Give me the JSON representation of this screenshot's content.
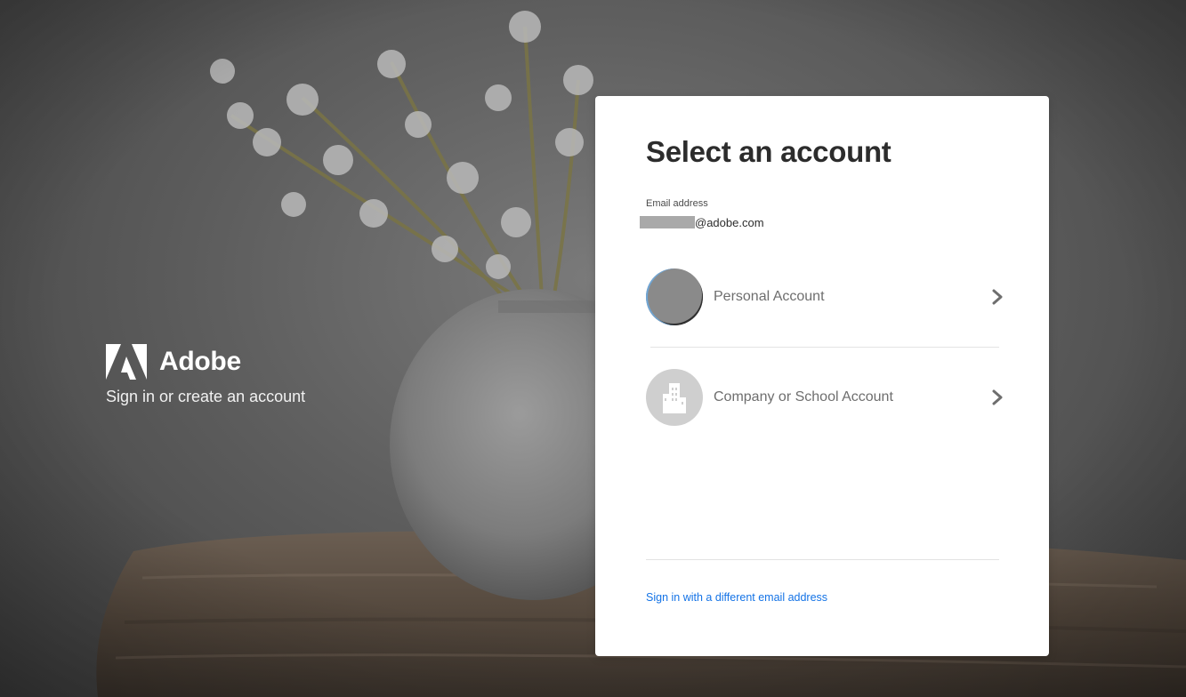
{
  "brand": {
    "name": "Adobe",
    "tagline": "Sign in or create an account",
    "logo_icon": "adobe-logo-icon"
  },
  "card": {
    "title": "Select an account",
    "email_label": "Email address",
    "email_domain": "@adobe.com",
    "accounts": [
      {
        "label": "Personal Account",
        "icon": "user-avatar-icon"
      },
      {
        "label": "Company or School Account",
        "icon": "building-icon"
      }
    ],
    "alt_link": "Sign in with a different email address"
  },
  "colors": {
    "link": "#1473e6",
    "title": "#2c2c2c",
    "muted_label": "#6e6e6e",
    "chevron": "#6e6e6e"
  }
}
